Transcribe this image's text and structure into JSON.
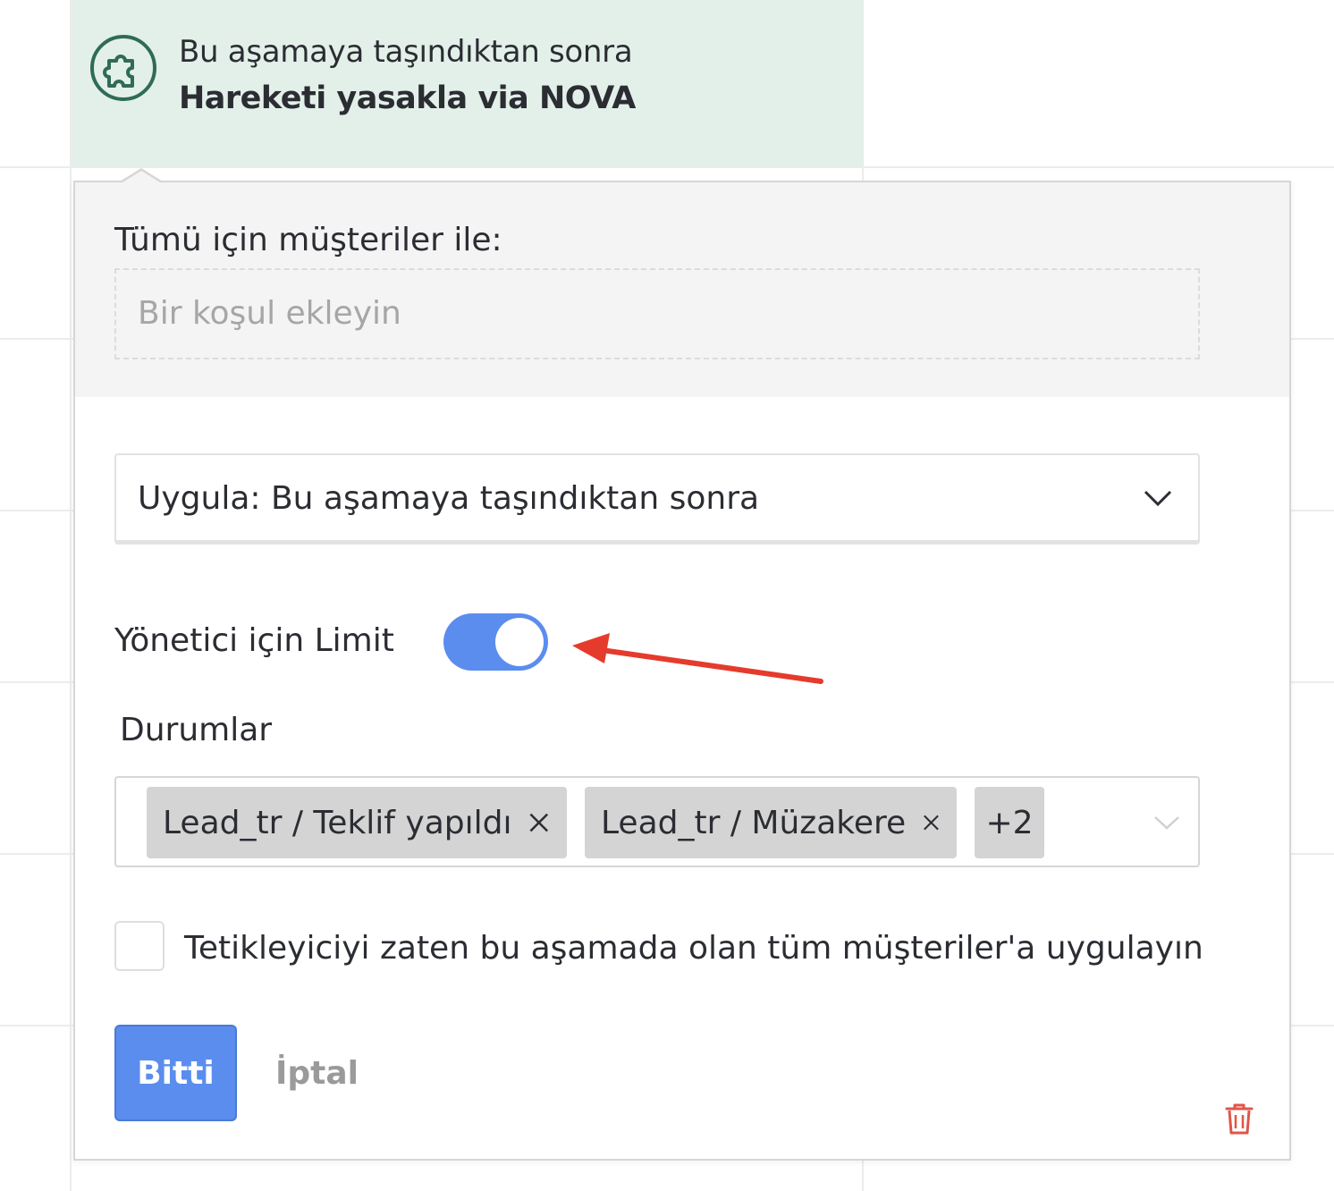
{
  "trigger": {
    "icon": "puzzle-piece-icon",
    "line1": "Bu aşamaya taşındıktan sonra",
    "line2": "Hareketi yasakla via NOVA"
  },
  "conditions": {
    "label": "Tümü için müşteriler ile:",
    "placeholder": "Bir koşul ekleyin"
  },
  "apply": {
    "selected": "Uygula: Bu aşamaya taşındıktan sonra"
  },
  "limit": {
    "label": "Yönetici için Limit",
    "enabled": true
  },
  "statuses": {
    "label": "Durumlar",
    "chips": [
      "Lead_tr / Teklif yapıldı",
      "Lead_tr / Müzakere"
    ],
    "more": "+2"
  },
  "apply_existing": {
    "label": "Tetikleyiciyi zaten bu aşamada olan tüm müşteriler'a uygulayın",
    "checked": false
  },
  "actions": {
    "done": "Bitti",
    "cancel": "İptal"
  },
  "colors": {
    "accent": "#5b8def",
    "trigger_bg": "#e3f0e9",
    "trigger_icon": "#2f6b58",
    "annotation_arrow": "#e53b2c",
    "delete": "#e0554a"
  }
}
